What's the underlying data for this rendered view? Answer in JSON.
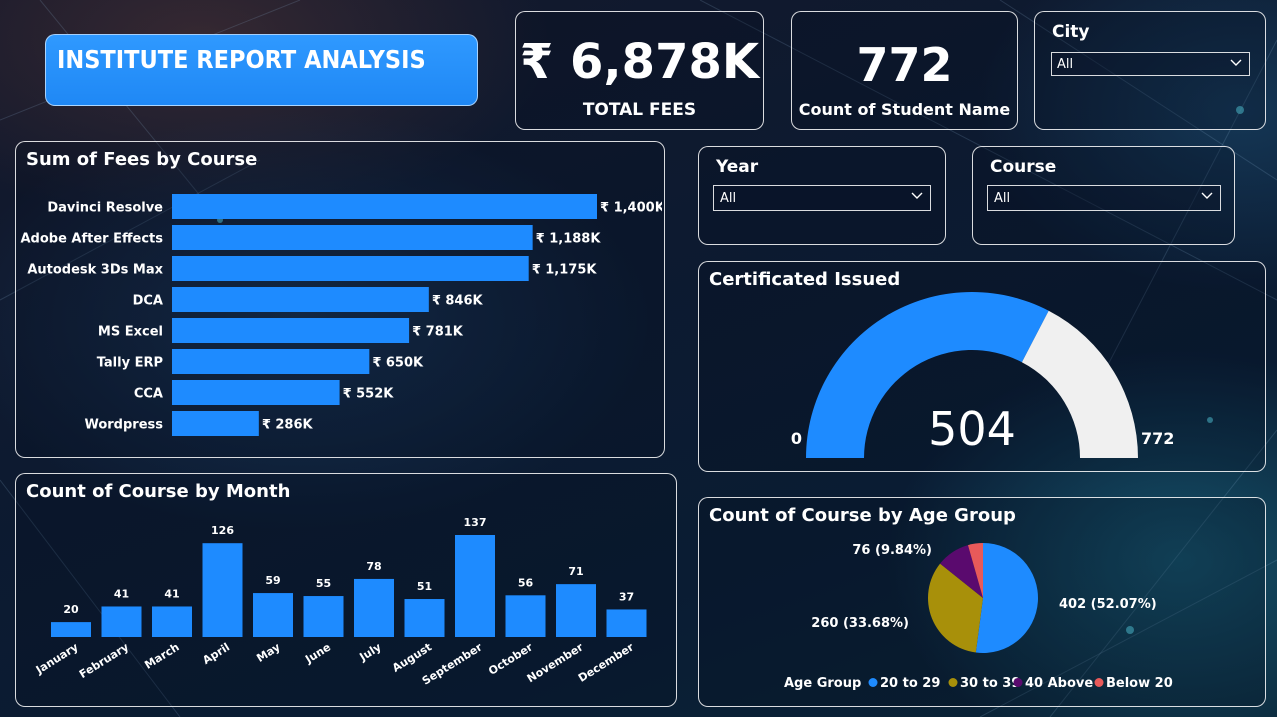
{
  "header": {
    "title": "INSTITUTE REPORT ANALYSIS"
  },
  "kpis": {
    "fees": {
      "value": "₹ 6,878K",
      "label": "TOTAL FEES"
    },
    "students": {
      "value": "772",
      "label": "Count of Student Name"
    }
  },
  "slicers": {
    "city": {
      "label": "City",
      "value": "All"
    },
    "year": {
      "label": "Year",
      "value": "All"
    },
    "course": {
      "label": "Course",
      "value": "All"
    }
  },
  "colors": {
    "accent": "#1e8bff",
    "gauge_track": "#f0f0f0"
  },
  "chart_data": [
    {
      "type": "bar",
      "orientation": "horizontal",
      "title": "Sum of Fees by Course",
      "categories": [
        "Davinci Resolve",
        "Adobe After Effects",
        "Autodesk 3Ds Max",
        "DCA",
        "MS Excel",
        "Tally ERP",
        "CCA",
        "Wordpress"
      ],
      "values": [
        1400,
        1188,
        1175,
        846,
        781,
        650,
        552,
        286
      ],
      "data_labels": [
        "₹ 1,400K",
        "₹ 1,188K",
        "₹ 1,175K",
        "₹ 846K",
        "₹ 781K",
        "₹ 650K",
        "₹ 552K",
        "₹ 286K"
      ],
      "unit": "K"
    },
    {
      "type": "bar",
      "title": "Count of Course by Month",
      "categories": [
        "January",
        "February",
        "March",
        "April",
        "May",
        "June",
        "July",
        "August",
        "September",
        "October",
        "November",
        "December"
      ],
      "values": [
        20,
        41,
        41,
        126,
        59,
        55,
        78,
        51,
        137,
        56,
        71,
        37
      ]
    },
    {
      "type": "gauge",
      "title": "Certificated Issued",
      "value": 504,
      "min": 0,
      "max": 772,
      "value_label": "504",
      "min_label": "0",
      "max_label": "772"
    },
    {
      "type": "pie",
      "title": "Count of Course by Age Group",
      "legend_title": "Age Group",
      "legend_position": "bottom",
      "categories": [
        "20 to 29",
        "30 to 39",
        "40 Above",
        "Below 20"
      ],
      "values": [
        402,
        260,
        76,
        34
      ],
      "colors": [
        "#1e8bff",
        "#a8900a",
        "#5a0a6e",
        "#e85a5a"
      ],
      "data_labels": [
        "402 (52.07%)",
        "260 (33.68%)",
        "76 (9.84%)",
        ""
      ]
    }
  ]
}
